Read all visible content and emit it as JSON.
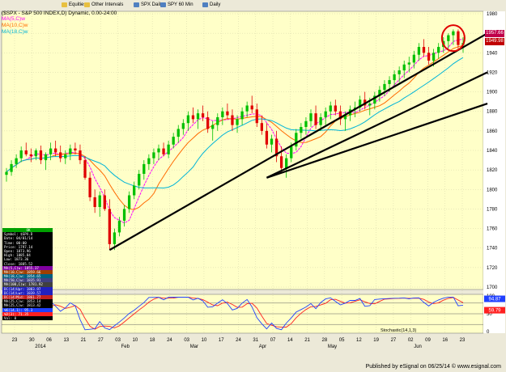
{
  "toolbar": {
    "items": [
      {
        "label": "Equities"
      },
      {
        "label": "Other Intervals"
      },
      {
        "label": "SPX Daily"
      },
      {
        "label": "SPY 60 Min"
      },
      {
        "label": "Daily"
      }
    ]
  },
  "title": "($SPX - S&P 500 INDEX,D) Dynamic, 0.00-24:00",
  "ma_labels": [
    {
      "text": "MA(5,C)w",
      "color": "#ff00ff"
    },
    {
      "text": "MA(10,C)w",
      "color": "#ff6a00"
    },
    {
      "text": "MA(18,C)w",
      "color": "#00b4d8"
    }
  ],
  "price_tags": {
    "top": "1957.66",
    "bottom": "1949.98"
  },
  "info_panel": {
    "header": "OK",
    "rows": [
      {
        "text": "Symbol: $SPX.D",
        "bg": "#000000"
      },
      {
        "text": "Date: 04/01/14",
        "bg": "#000000"
      },
      {
        "text": "Time: 00:00",
        "bg": "#000000"
      },
      {
        "text": "Price: 1797.14",
        "bg": "#000000"
      },
      {
        "text": "Open: 1873.96",
        "bg": "#000000"
      },
      {
        "text": "High: 1885.84",
        "bg": "#000000"
      },
      {
        "text": "Low: 1873.36",
        "bg": "#000000"
      },
      {
        "text": "Close: 1885.52",
        "bg": "#000000"
      },
      {
        "text": "MA(5,C)w: 1855.37",
        "bg": "#8000a0"
      },
      {
        "text": "MA(10,C)w: 1859.66",
        "bg": "#a04000"
      },
      {
        "text": "MA(18,C)w: 1854.65",
        "bg": "#006080"
      },
      {
        "text": "MA(50,C)w: 1835.91",
        "bg": "#404080"
      },
      {
        "text": "MA(100,C)w: 1781.92",
        "bg": "#404040"
      },
      {
        "text": "DC(14)Upr: 1883.97",
        "bg": "#2020c0"
      },
      {
        "text": "DC(14)Lwr: 1839.57",
        "bg": "#2020c0"
      },
      {
        "text": "DC(14)Mid: 1861.77",
        "bg": "#c02020"
      },
      {
        "text": "MA(25,C)w: 1853.14",
        "bg": "#000000"
      },
      {
        "text": "MA(25,C)w: 1813.42",
        "bg": "#000000"
      },
      {
        "text": "%K(14,1): 95.3",
        "bg": "#2040ff"
      },
      {
        "text": "%D(3): 71.35",
        "bg": "#ff2020"
      },
      {
        "text": "Vol: 0",
        "bg": "#000000"
      }
    ]
  },
  "stoch_label": "Stochastic(14,1,3)",
  "stoch_tags": {
    "k": "94.87",
    "d": "59.79"
  },
  "footer": "Published by eSignal on 06/25/14 © www.esignal.com",
  "chart_data": {
    "type": "candlestick",
    "title": "($SPX - S&P 500 INDEX,D) Dynamic, 0.00-24:00",
    "ylim": [
      1700,
      1980
    ],
    "yticks": [
      1700,
      1720,
      1740,
      1760,
      1780,
      1800,
      1820,
      1840,
      1860,
      1880,
      1900,
      1920,
      1940,
      1960,
      1980
    ],
    "x_tick_labels": [
      "23",
      "30",
      "06",
      "13",
      "21",
      "27",
      "03",
      "10",
      "18",
      "24",
      "03",
      "10",
      "17",
      "24",
      "31",
      "07",
      "14",
      "21",
      "28",
      "05",
      "12",
      "19",
      "27",
      "02",
      "09",
      "16",
      "23"
    ],
    "month_labels": [
      "2014",
      "Feb",
      "Mar",
      "Apr",
      "May",
      "Jun"
    ],
    "candles": [
      [
        1815,
        1822,
        1808,
        1818
      ],
      [
        1818,
        1830,
        1814,
        1826
      ],
      [
        1826,
        1836,
        1822,
        1832
      ],
      [
        1832,
        1844,
        1828,
        1840
      ],
      [
        1840,
        1848,
        1834,
        1836
      ],
      [
        1836,
        1842,
        1828,
        1834
      ],
      [
        1834,
        1842,
        1830,
        1840
      ],
      [
        1840,
        1845,
        1826,
        1830
      ],
      [
        1830,
        1838,
        1820,
        1836
      ],
      [
        1836,
        1848,
        1830,
        1842
      ],
      [
        1842,
        1850,
        1834,
        1838
      ],
      [
        1838,
        1845,
        1828,
        1832
      ],
      [
        1832,
        1840,
        1826,
        1836
      ],
      [
        1836,
        1846,
        1830,
        1842
      ],
      [
        1842,
        1848,
        1836,
        1840
      ],
      [
        1840,
        1846,
        1826,
        1830
      ],
      [
        1830,
        1834,
        1810,
        1812
      ],
      [
        1812,
        1818,
        1788,
        1792
      ],
      [
        1792,
        1800,
        1776,
        1782
      ],
      [
        1782,
        1798,
        1772,
        1794
      ],
      [
        1794,
        1800,
        1778,
        1780
      ],
      [
        1780,
        1790,
        1738,
        1744
      ],
      [
        1744,
        1760,
        1738,
        1756
      ],
      [
        1756,
        1772,
        1752,
        1768
      ],
      [
        1768,
        1784,
        1762,
        1780
      ],
      [
        1780,
        1798,
        1776,
        1794
      ],
      [
        1794,
        1808,
        1790,
        1804
      ],
      [
        1804,
        1820,
        1800,
        1816
      ],
      [
        1816,
        1830,
        1810,
        1826
      ],
      [
        1826,
        1836,
        1820,
        1832
      ],
      [
        1832,
        1842,
        1826,
        1838
      ],
      [
        1838,
        1846,
        1830,
        1842
      ],
      [
        1842,
        1848,
        1834,
        1836
      ],
      [
        1836,
        1850,
        1832,
        1846
      ],
      [
        1846,
        1858,
        1842,
        1854
      ],
      [
        1854,
        1866,
        1848,
        1862
      ],
      [
        1862,
        1872,
        1856,
        1868
      ],
      [
        1868,
        1880,
        1860,
        1876
      ],
      [
        1876,
        1884,
        1868,
        1872
      ],
      [
        1872,
        1882,
        1862,
        1878
      ],
      [
        1878,
        1886,
        1870,
        1874
      ],
      [
        1874,
        1880,
        1858,
        1862
      ],
      [
        1862,
        1870,
        1850,
        1866
      ],
      [
        1866,
        1878,
        1860,
        1874
      ],
      [
        1874,
        1884,
        1866,
        1880
      ],
      [
        1880,
        1888,
        1872,
        1876
      ],
      [
        1876,
        1882,
        1860,
        1866
      ],
      [
        1866,
        1876,
        1858,
        1872
      ],
      [
        1872,
        1884,
        1866,
        1880
      ],
      [
        1880,
        1890,
        1874,
        1886
      ],
      [
        1886,
        1896,
        1878,
        1882
      ],
      [
        1882,
        1888,
        1864,
        1868
      ],
      [
        1868,
        1876,
        1856,
        1860
      ],
      [
        1860,
        1868,
        1842,
        1846
      ],
      [
        1846,
        1856,
        1838,
        1852
      ],
      [
        1852,
        1860,
        1828,
        1834
      ],
      [
        1834,
        1844,
        1818,
        1822
      ],
      [
        1822,
        1836,
        1812,
        1832
      ],
      [
        1832,
        1848,
        1828,
        1844
      ],
      [
        1844,
        1862,
        1840,
        1858
      ],
      [
        1858,
        1868,
        1852,
        1864
      ],
      [
        1864,
        1874,
        1856,
        1870
      ],
      [
        1870,
        1882,
        1864,
        1878
      ],
      [
        1878,
        1886,
        1862,
        1866
      ],
      [
        1866,
        1878,
        1860,
        1874
      ],
      [
        1874,
        1884,
        1866,
        1880
      ],
      [
        1880,
        1890,
        1872,
        1886
      ],
      [
        1886,
        1892,
        1876,
        1880
      ],
      [
        1880,
        1886,
        1866,
        1872
      ],
      [
        1872,
        1880,
        1860,
        1876
      ],
      [
        1876,
        1886,
        1870,
        1882
      ],
      [
        1882,
        1890,
        1874,
        1884
      ],
      [
        1884,
        1896,
        1880,
        1892
      ],
      [
        1892,
        1900,
        1882,
        1886
      ],
      [
        1886,
        1894,
        1876,
        1888
      ],
      [
        1888,
        1900,
        1882,
        1896
      ],
      [
        1896,
        1906,
        1890,
        1902
      ],
      [
        1902,
        1912,
        1896,
        1908
      ],
      [
        1908,
        1916,
        1900,
        1912
      ],
      [
        1912,
        1922,
        1906,
        1918
      ],
      [
        1918,
        1926,
        1910,
        1922
      ],
      [
        1922,
        1932,
        1914,
        1928
      ],
      [
        1928,
        1936,
        1920,
        1930
      ],
      [
        1930,
        1942,
        1924,
        1938
      ],
      [
        1938,
        1950,
        1932,
        1946
      ],
      [
        1946,
        1954,
        1936,
        1940
      ],
      [
        1940,
        1946,
        1928,
        1932
      ],
      [
        1932,
        1944,
        1926,
        1940
      ],
      [
        1940,
        1950,
        1934,
        1946
      ],
      [
        1946,
        1956,
        1940,
        1952
      ],
      [
        1952,
        1960,
        1944,
        1958
      ],
      [
        1958,
        1964,
        1948,
        1962
      ],
      [
        1962,
        1964,
        1944,
        1948
      ],
      [
        1948,
        1956,
        1940,
        1950
      ]
    ],
    "trendlines": [
      {
        "from": [
          21,
          1738
        ],
        "to": [
          94,
          1960
        ]
      },
      {
        "from": [
          53,
          1812
        ],
        "to": [
          94,
          1920
        ]
      },
      {
        "from": [
          53,
          1812
        ],
        "to": [
          94,
          1888
        ]
      }
    ],
    "stochastic": {
      "ylim": [
        0,
        100
      ],
      "yticks": [
        0,
        20,
        50,
        80,
        100
      ]
    }
  }
}
